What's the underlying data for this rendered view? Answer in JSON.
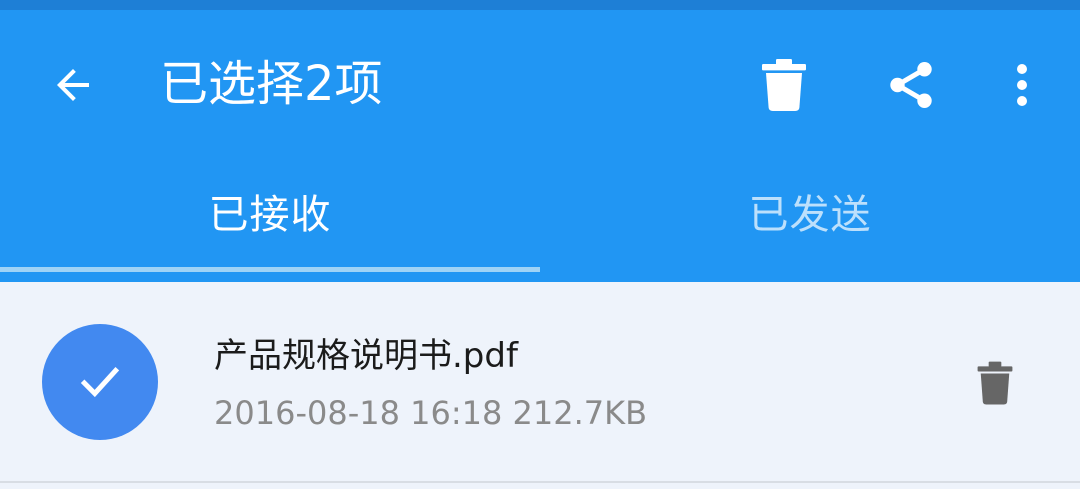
{
  "app_bar": {
    "title": "已选择2项",
    "back_icon": "arrow-back-icon",
    "actions": [
      {
        "icon": "trash-icon"
      },
      {
        "icon": "share-icon"
      },
      {
        "icon": "more-vert-icon"
      }
    ]
  },
  "tabs": [
    {
      "label": "已接收",
      "selected": true
    },
    {
      "label": "已发送",
      "selected": false
    }
  ],
  "files": [
    {
      "name": "产品规格说明书.pdf",
      "meta": "2016-08-18 16:18 212.7KB",
      "checked": true
    }
  ],
  "colors": {
    "app_bar": "#2196f3",
    "status_strip": "#1e7fd6",
    "tab_indicator": "#9fd3f6",
    "check_circle": "#4289f0",
    "list_background": "#eef3fb"
  }
}
